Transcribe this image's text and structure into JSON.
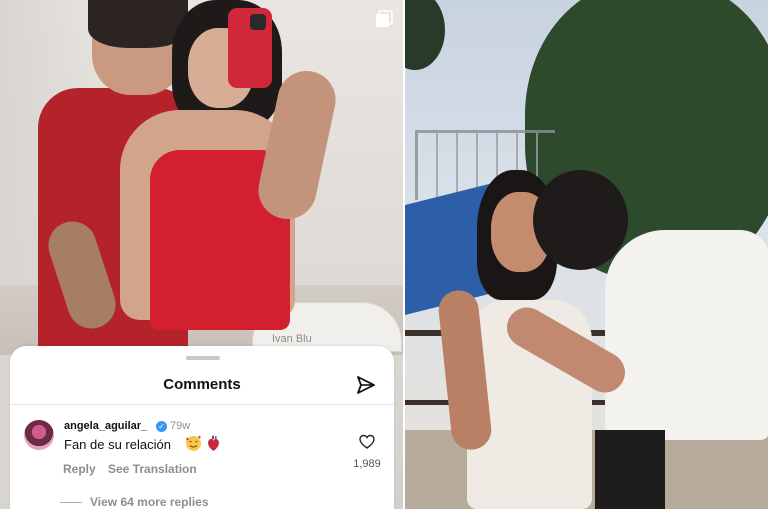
{
  "left_photo": {
    "watermark": "Ivan Blu",
    "multi_post_icon": "square-stack-icon"
  },
  "comments_sheet": {
    "title": "Comments",
    "send_icon": "paper-plane-icon",
    "comment": {
      "username": "angela_aguilar_",
      "verified_icon": "verified-badge-icon",
      "time": "79w",
      "text": "Fan de su relación",
      "emojis": [
        "smiling-face-with-hearts-emoji",
        "anatomical-heart-emoji"
      ],
      "reply_label": "Reply",
      "translation_label": "See Translation",
      "like_icon": "heart-outline-icon",
      "like_count": "1,989"
    },
    "view_replies": "View 64 more replies"
  },
  "colors": {
    "sheet_bg": "#ffffff",
    "secondary_text": "#8e8e8e",
    "verified_blue": "#3897f0"
  }
}
